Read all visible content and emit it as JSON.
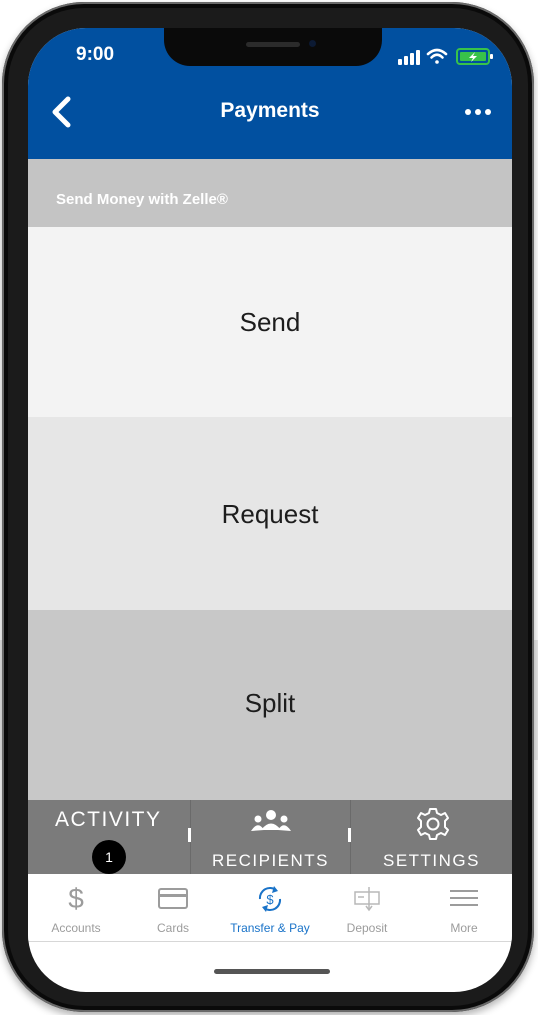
{
  "status_bar": {
    "time": "9:00"
  },
  "nav": {
    "title": "Payments"
  },
  "section": {
    "header": "Send Money with Zelle®"
  },
  "options": [
    {
      "label": "Send"
    },
    {
      "label": "Request"
    },
    {
      "label": "Split"
    }
  ],
  "tabs": {
    "activity": {
      "label": "ACTIVITY",
      "badge": "1"
    },
    "recipients": {
      "label": "RECIPIENTS"
    },
    "settings": {
      "label": "SETTINGS"
    }
  },
  "bottom_nav": [
    {
      "label": "Accounts",
      "icon": "dollar-icon",
      "active": false
    },
    {
      "label": "Cards",
      "icon": "card-icon",
      "active": false
    },
    {
      "label": "Transfer & Pay",
      "icon": "transfer-pay-icon",
      "active": true
    },
    {
      "label": "Deposit",
      "icon": "deposit-icon",
      "active": false
    },
    {
      "label": "More",
      "icon": "menu-icon",
      "active": false
    }
  ],
  "colors": {
    "header_blue": "#0150a0",
    "section_gray": "#c4c4c4",
    "tab_gray": "#7b7b7b",
    "active_blue": "#1a73c8"
  }
}
